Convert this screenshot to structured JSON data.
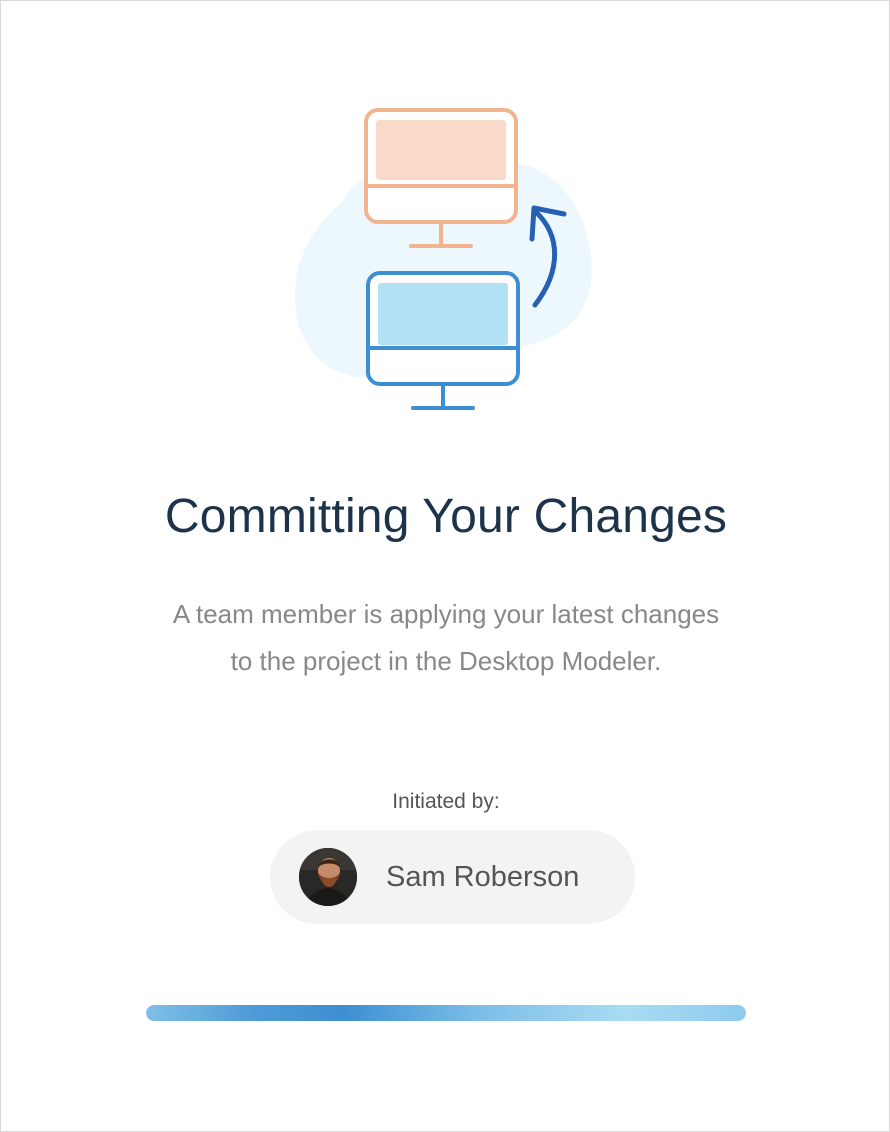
{
  "dialog": {
    "title": "Committing Your Changes",
    "description_line1": "A team member is applying your latest changes",
    "description_line2": "to the project in the Desktop Modeler.",
    "initiated_label": "Initiated by:",
    "user": {
      "name": "Sam Roberson",
      "avatar_icon": "user-avatar-photo"
    },
    "progress": {
      "fraction": 1.0,
      "state": "indeterminate"
    },
    "illustration": {
      "icon": "computer-sync-icon"
    }
  },
  "colors": {
    "title": "#1c3349",
    "description": "#888888",
    "monitor_top": "#f2b48f",
    "monitor_top_fill": "#f9d9c9",
    "monitor_bottom": "#3e8fd2",
    "monitor_bottom_fill": "#b2e1f6",
    "blob": "#ecf8fd",
    "arrow": "#2560b4",
    "chip_background": "#f3f3f3"
  }
}
